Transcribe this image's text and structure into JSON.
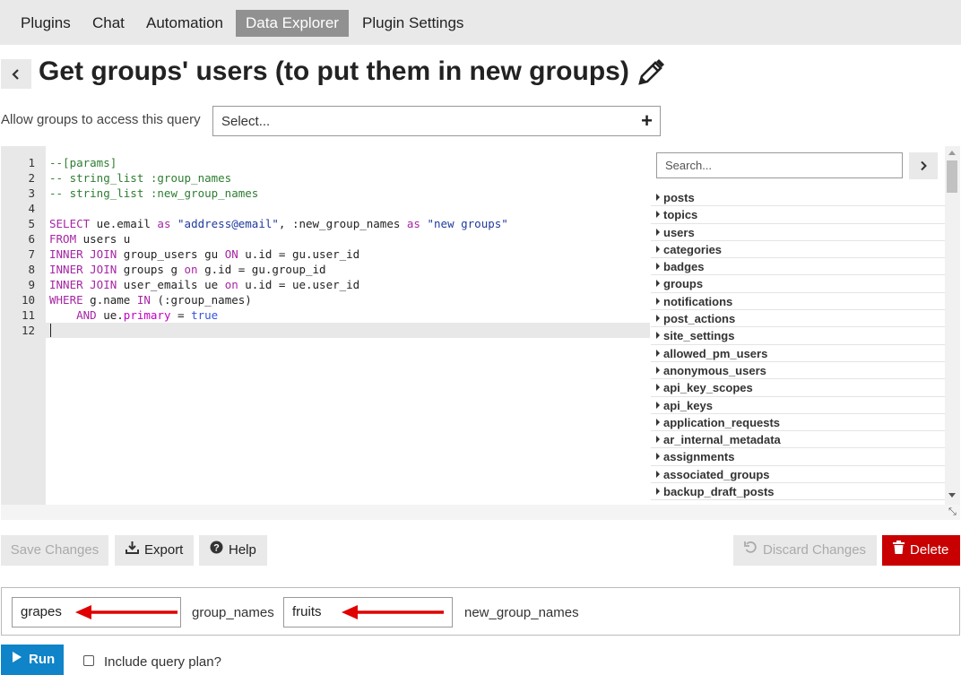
{
  "nav": {
    "tabs": [
      {
        "label": "Plugins"
      },
      {
        "label": "Chat"
      },
      {
        "label": "Automation"
      },
      {
        "label": "Data Explorer",
        "active": true
      },
      {
        "label": "Plugin Settings"
      }
    ]
  },
  "query": {
    "title": "Get groups' users (to put them in new groups)",
    "access_label": "Allow groups to access this query",
    "access_placeholder": "Select..."
  },
  "editor": {
    "line_numbers": [
      "1",
      "2",
      "3",
      "4",
      "5",
      "6",
      "7",
      "8",
      "9",
      "10",
      "11",
      "12"
    ],
    "lines": [
      "--[params]",
      "-- string_list :group_names",
      "-- string_list :new_group_names",
      "",
      "SELECT ue.email as \"address@email\", :new_group_names as \"new groups\"",
      "FROM users u",
      "INNER JOIN group_users gu ON u.id = gu.user_id",
      "INNER JOIN groups g on g.id = gu.group_id",
      "INNER JOIN user_emails ue on u.id = ue.user_id",
      "WHERE g.name IN (:group_names)",
      "    AND ue.primary = true",
      ""
    ]
  },
  "schema": {
    "search_placeholder": "Search...",
    "tables": [
      "posts",
      "topics",
      "users",
      "categories",
      "badges",
      "groups",
      "notifications",
      "post_actions",
      "site_settings",
      "allowed_pm_users",
      "anonymous_users",
      "api_key_scopes",
      "api_keys",
      "application_requests",
      "ar_internal_metadata",
      "assignments",
      "associated_groups",
      "backup_draft_posts"
    ]
  },
  "actions": {
    "save": "Save Changes",
    "export": "Export",
    "help": "Help",
    "discard": "Discard Changes",
    "delete": "Delete"
  },
  "params": {
    "group_names_value": "grapes",
    "group_names_label": "group_names",
    "new_group_names_value": "fruits",
    "new_group_names_label": "new_group_names"
  },
  "run": {
    "label": "Run",
    "query_plan_label": "Include query plan?"
  },
  "colors": {
    "active_tab": "#919191",
    "run_button": "#0f84c9",
    "delete_button": "#c80001",
    "annotation_arrow": "#e00000"
  }
}
